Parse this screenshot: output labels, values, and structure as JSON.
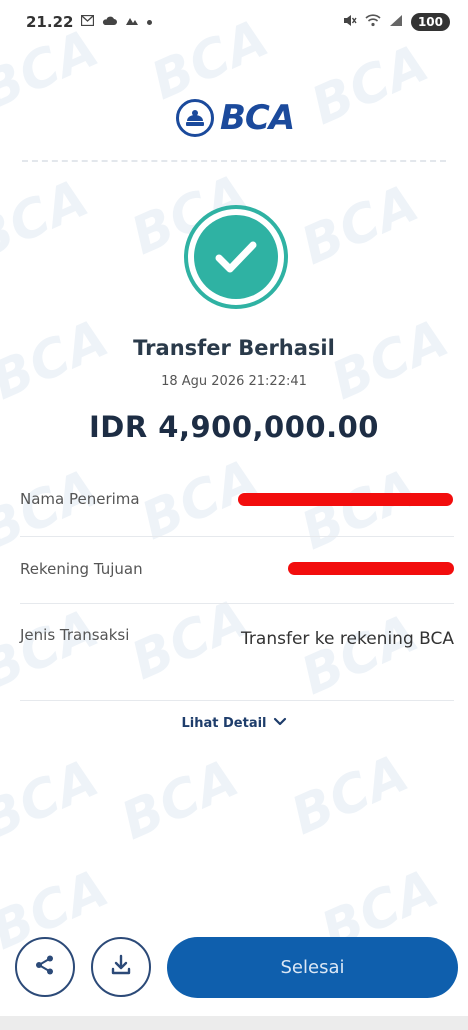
{
  "status_bar": {
    "time": "21.22",
    "battery": "100"
  },
  "header": {
    "logo_text": "BCA"
  },
  "receipt": {
    "title": "Transfer Berhasil",
    "timestamp": "18 Agu 2026 21:22:41",
    "amount": "IDR 4,900,000.00",
    "details": [
      {
        "label": "Nama Penerima",
        "value": ""
      },
      {
        "label": "Rekening Tujuan",
        "value": ""
      },
      {
        "label": "Jenis Transaksi",
        "value": "Transfer ke rekening BCA"
      }
    ],
    "more_detail_label": "Lihat Detail"
  },
  "actions": {
    "share_icon": "share-icon",
    "download_icon": "download-icon",
    "done_label": "Selesai"
  },
  "colors": {
    "brand": "#1b4a9c",
    "success": "#2fb2a3",
    "primary_button": "#0f5fad",
    "redaction": "#f20d0d"
  }
}
